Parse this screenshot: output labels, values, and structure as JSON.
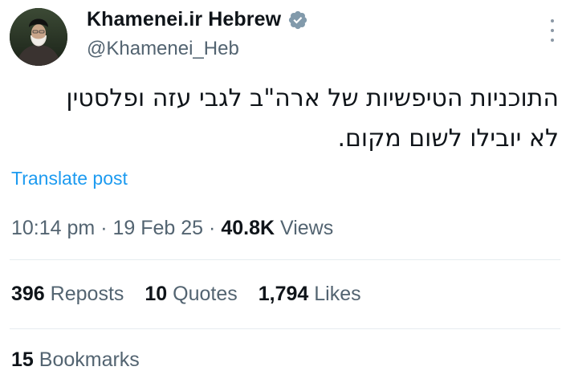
{
  "author": {
    "display_name": "Khamenei.ir Hebrew",
    "handle": "@Khamenei_Heb",
    "verified_icon": "verified-badge-icon"
  },
  "tweet": {
    "lines": [
      "התוכניות הטיפשיות של ארה\"ב לגבי עזה ופלסטין",
      "לא יובילו לשום מקום."
    ],
    "translate_label": "Translate post"
  },
  "meta": {
    "time": "10:14 pm",
    "separator": "·",
    "date": "19 Feb 25",
    "views_count": "40.8K",
    "views_label": "Views"
  },
  "stats": {
    "reposts_count": "396",
    "reposts_label": "Reposts",
    "quotes_count": "10",
    "quotes_label": "Quotes",
    "likes_count": "1,794",
    "likes_label": "Likes",
    "bookmarks_count": "15",
    "bookmarks_label": "Bookmarks"
  },
  "colors": {
    "link": "#1d9bf0",
    "muted": "#536471",
    "text": "#0f1419",
    "verified": "#829aab"
  }
}
